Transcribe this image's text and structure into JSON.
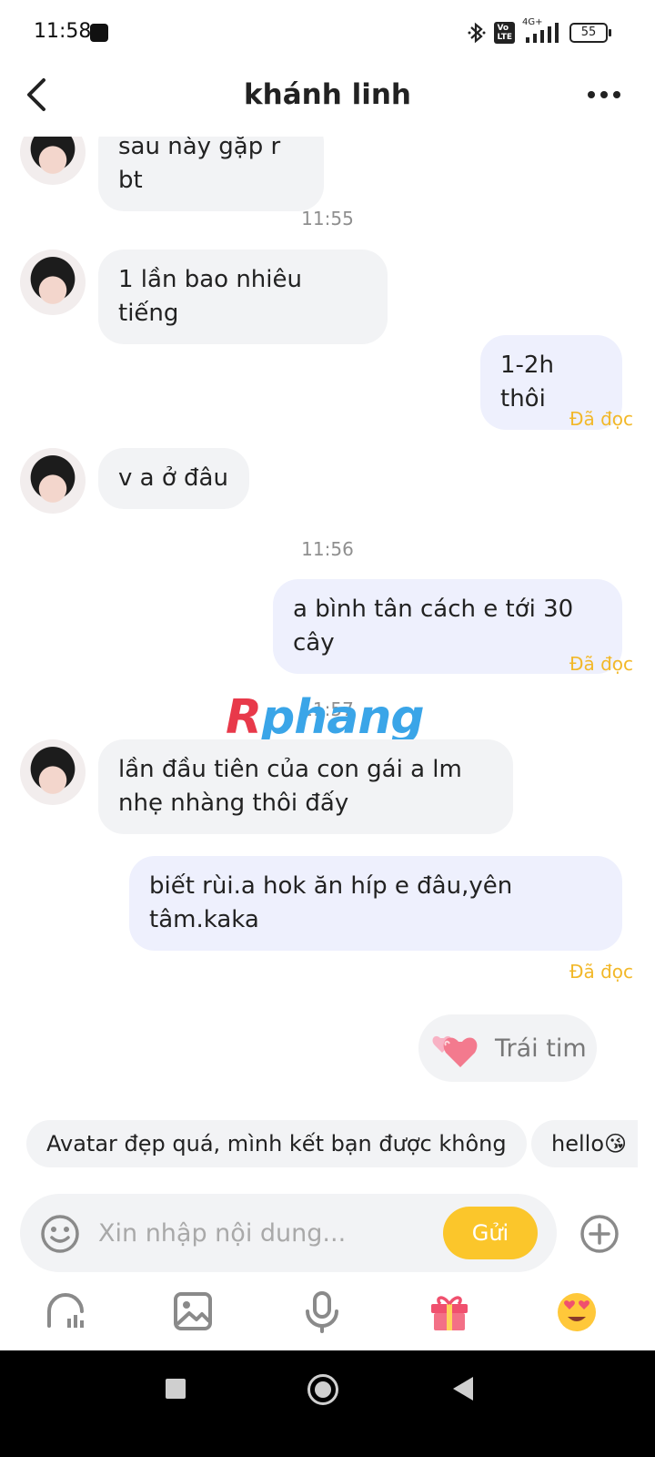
{
  "status_bar": {
    "time": "11:58",
    "network": "4G+",
    "battery": "55"
  },
  "header": {
    "title": "khánh linh"
  },
  "messages": [
    {
      "side": "in",
      "text": "sau này gặp r bt"
    },
    {
      "type": "timestamp",
      "text": "11:55"
    },
    {
      "side": "in",
      "text": "1 lần bao nhiêu tiếng"
    },
    {
      "side": "out",
      "text": "1-2h thôi",
      "status": "Đã đọc"
    },
    {
      "side": "in",
      "text": "v a ở đâu"
    },
    {
      "type": "timestamp",
      "text": "11:56"
    },
    {
      "side": "out",
      "text": "a bình tân cách e tới 30 cây",
      "status": "Đã đọc"
    },
    {
      "type": "timestamp",
      "text": "11:57"
    },
    {
      "side": "in",
      "text": "lần đầu tiên của con gái a lm nhẹ nhàng thôi đấy"
    },
    {
      "side": "out",
      "text": "biết rùi.a hok ăn híp e đâu,yên tâm.kaka",
      "status": "Đã đọc"
    }
  ],
  "watermark": {
    "first": "R",
    "rest": "phang"
  },
  "heart_reaction": {
    "label": "Trái tim"
  },
  "suggestions": [
    "Avatar đẹp quá, mình kết bạn được không",
    "hello😘"
  ],
  "composer": {
    "placeholder": "Xin nhập nội dung...",
    "send_label": "Gửi"
  },
  "toolbar": {
    "icons": [
      "stats-icon",
      "image-icon",
      "microphone-icon",
      "gift-icon",
      "heart-eyes-emoji-icon"
    ]
  },
  "colors": {
    "accent": "#fbc62b",
    "read_status": "#f2b829",
    "incoming_bubble": "#f2f3f5",
    "outgoing_bubble": "#eef0fd",
    "gift": "#f0506e"
  }
}
